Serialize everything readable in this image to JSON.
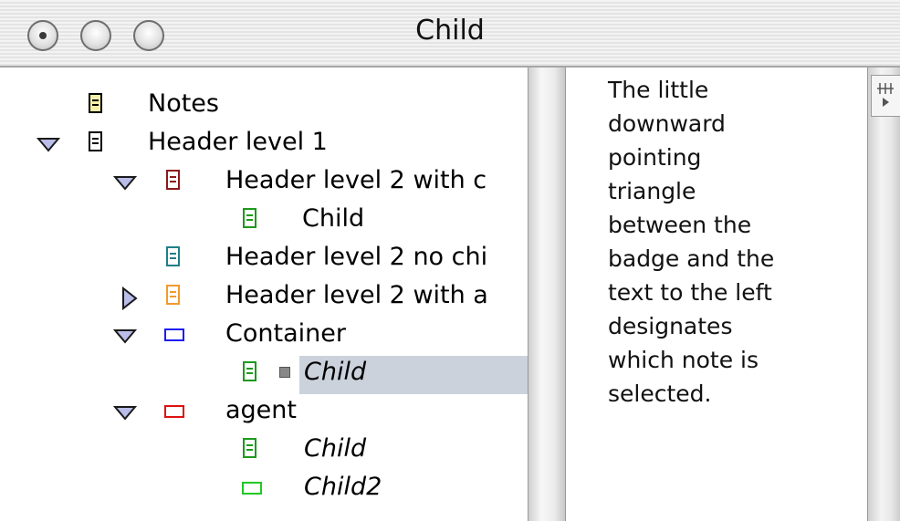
{
  "window": {
    "title": "Child",
    "buttons": [
      "close-button",
      "minimize-button",
      "zoom-button"
    ]
  },
  "outline": {
    "items": [
      {
        "label": "Notes",
        "italic": false,
        "expanded": null,
        "badge": "note",
        "color": "#000000"
      },
      {
        "label": "Header level 1",
        "italic": false,
        "expanded": true,
        "badge": "page",
        "color": "#000000"
      },
      {
        "label": "Header level 2 with c",
        "italic": false,
        "expanded": true,
        "badge": "page",
        "color": "#8b1a1a"
      },
      {
        "label": "Child",
        "italic": false,
        "expanded": null,
        "badge": "page",
        "color": "#1c9a1c"
      },
      {
        "label": "Header level 2 no chi",
        "italic": false,
        "expanded": null,
        "badge": "page",
        "color": "#1f7f86"
      },
      {
        "label": "Header level 2 with a",
        "italic": false,
        "expanded": false,
        "badge": "page",
        "color": "#f29a2e"
      },
      {
        "label": "Container",
        "italic": false,
        "expanded": true,
        "badge": "box",
        "color": "#1d1df0"
      },
      {
        "label": "Child",
        "italic": true,
        "expanded": null,
        "badge": "page",
        "color": "#1c9a1c",
        "selected": true
      },
      {
        "label": "agent",
        "italic": false,
        "expanded": true,
        "badge": "box",
        "color": "#e01010"
      },
      {
        "label": "Child",
        "italic": true,
        "expanded": null,
        "badge": "page",
        "color": "#1c9a1c"
      },
      {
        "label": "Child2",
        "italic": true,
        "expanded": null,
        "badge": "box",
        "color": "#22c822"
      }
    ]
  },
  "note_text": {
    "body": "The little\ndownward\npointing\ntriangle\nbetween the\nbadge and the\ntext to the left\ndesignates\nwhich note is\nselected."
  },
  "colors": {
    "selection": "#cbd2dc",
    "triangle": "#b9bde8"
  }
}
